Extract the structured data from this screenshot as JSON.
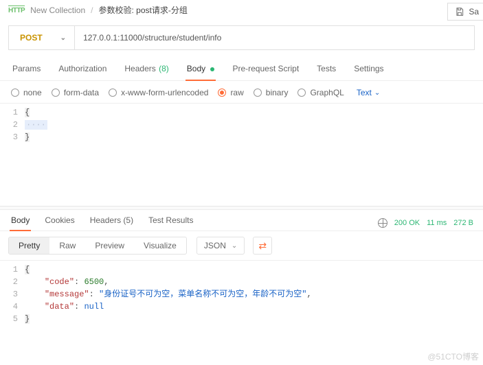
{
  "breadcrumb": {
    "http_badge": "HTTP",
    "collection": "New Collection",
    "sep": "/",
    "title": "参数校验: post请求-分组"
  },
  "save_button": {
    "label": "Sa"
  },
  "request": {
    "method": "POST",
    "url": "127.0.0.1:11000/structure/student/info"
  },
  "req_tabs": {
    "params": "Params",
    "authorization": "Authorization",
    "headers": "Headers",
    "headers_count": "(8)",
    "body": "Body",
    "prerequest": "Pre-request Script",
    "tests": "Tests",
    "settings": "Settings"
  },
  "body_types": {
    "none": "none",
    "formdata": "form-data",
    "xwww": "x-www-form-urlencoded",
    "raw": "raw",
    "binary": "binary",
    "graphql": "GraphQL",
    "textmode": "Text"
  },
  "request_body": {
    "lines": {
      "l1": "1",
      "l2": "2",
      "l3": "3"
    },
    "code": {
      "c1": "{",
      "c2": "····",
      "c3": "}"
    }
  },
  "resp_tabs": {
    "body": "Body",
    "cookies": "Cookies",
    "headers": "Headers",
    "headers_count": "(5)",
    "testresults": "Test Results"
  },
  "status": {
    "code": "200 OK",
    "time": "11 ms",
    "size": "272 B"
  },
  "resp_modes": {
    "pretty": "Pretty",
    "raw": "Raw",
    "preview": "Preview",
    "visualize": "Visualize",
    "lang": "JSON"
  },
  "response": {
    "lines": {
      "l1": "1",
      "l2": "2",
      "l3": "3",
      "l4": "4",
      "l5": "5"
    },
    "open": "{",
    "k_code": "\"code\"",
    "v_code": "6500",
    "k_msg": "\"message\"",
    "v_msg": "\"身份证号不可为空，菜单名称不可为空，年龄不可为空\"",
    "k_data": "\"data\"",
    "v_data": "null",
    "close": "}",
    "colon_sp": ": ",
    "comma": ","
  },
  "watermark": "@51CTO博客"
}
